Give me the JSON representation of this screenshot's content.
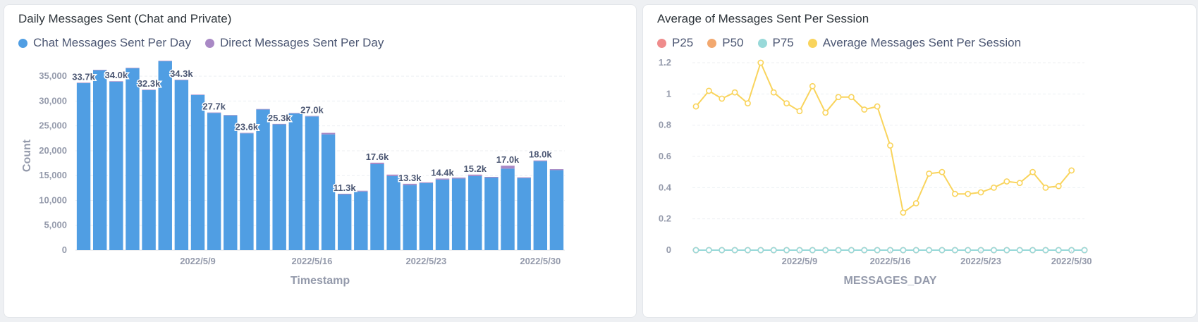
{
  "left_card": {
    "title": "Daily Messages Sent (Chat and Private)",
    "legend": [
      {
        "label": "Chat Messages Sent Per Day",
        "color": "#509ee3"
      },
      {
        "label": "Direct Messages Sent Per Day",
        "color": "#a989c5"
      }
    ]
  },
  "right_card": {
    "title": "Average of Messages Sent Per Session",
    "legend": [
      {
        "label": "P25",
        "color": "#ef8c8c"
      },
      {
        "label": "P50",
        "color": "#f2a86f"
      },
      {
        "label": "P75",
        "color": "#98d9d9"
      },
      {
        "label": "Average Messages Sent Per Session",
        "color": "#f9d45c"
      }
    ]
  },
  "chart_data": [
    {
      "type": "bar",
      "stacked": true,
      "title": "Daily Messages Sent (Chat and Private)",
      "xlabel": "Timestamp",
      "ylabel": "Count",
      "ylim": [
        0,
        38000
      ],
      "yticks": [
        0,
        5000,
        10000,
        15000,
        20000,
        25000,
        30000,
        35000
      ],
      "ytick_labels": [
        "0",
        "5,000",
        "10,000",
        "15,000",
        "20,000",
        "25,000",
        "30,000",
        "35,000"
      ],
      "xtick_labels": [
        {
          "label": "2022/5/9",
          "at": "2022-05-09"
        },
        {
          "label": "2022/5/16",
          "at": "2022-05-16"
        },
        {
          "label": "2022/5/23",
          "at": "2022-05-23"
        },
        {
          "label": "2022/5/30",
          "at": "2022-05-30"
        }
      ],
      "grid": true,
      "legend_position": "top-left",
      "categories": [
        "2022-05-02",
        "2022-05-03",
        "2022-05-04",
        "2022-05-05",
        "2022-05-06",
        "2022-05-07",
        "2022-05-08",
        "2022-05-09",
        "2022-05-10",
        "2022-05-11",
        "2022-05-12",
        "2022-05-13",
        "2022-05-14",
        "2022-05-15",
        "2022-05-16",
        "2022-05-17",
        "2022-05-18",
        "2022-05-19",
        "2022-05-20",
        "2022-05-21",
        "2022-05-22",
        "2022-05-23",
        "2022-05-24",
        "2022-05-25",
        "2022-05-26",
        "2022-05-27",
        "2022-05-28",
        "2022-05-29",
        "2022-05-30",
        "2022-05-31"
      ],
      "series": [
        {
          "name": "Chat Messages Sent Per Day",
          "color": "#509ee3",
          "values": [
            33600,
            36200,
            33900,
            36600,
            32200,
            38000,
            34200,
            31200,
            27600,
            27100,
            23500,
            28300,
            25300,
            27500,
            26900,
            23300,
            11200,
            11800,
            17300,
            14900,
            13100,
            13500,
            14200,
            14400,
            14900,
            14600,
            16400,
            14500,
            17900,
            16100
          ]
        },
        {
          "name": "Direct Messages Sent Per Day",
          "color": "#a989c5",
          "values": [
            100,
            100,
            100,
            100,
            100,
            100,
            100,
            100,
            100,
            100,
            100,
            100,
            100,
            100,
            100,
            300,
            150,
            150,
            300,
            300,
            250,
            150,
            200,
            200,
            300,
            150,
            600,
            150,
            150,
            200
          ]
        }
      ],
      "data_labels": [
        {
          "index": 0,
          "text": "33.7k"
        },
        {
          "index": 2,
          "text": "34.0k"
        },
        {
          "index": 4,
          "text": "32.3k"
        },
        {
          "index": 6,
          "text": "34.3k"
        },
        {
          "index": 8,
          "text": "27.7k"
        },
        {
          "index": 10,
          "text": "23.6k"
        },
        {
          "index": 12,
          "text": "25.3k"
        },
        {
          "index": 14,
          "text": "27.0k"
        },
        {
          "index": 16,
          "text": "11.3k"
        },
        {
          "index": 18,
          "text": "17.6k"
        },
        {
          "index": 20,
          "text": "13.3k"
        },
        {
          "index": 22,
          "text": "14.4k"
        },
        {
          "index": 24,
          "text": "15.2k"
        },
        {
          "index": 26,
          "text": "17.0k"
        },
        {
          "index": 28,
          "text": "18.0k"
        }
      ]
    },
    {
      "type": "line",
      "title": "Average of Messages Sent Per Session",
      "xlabel": "MESSAGES_DAY",
      "ylabel": "",
      "ylim": [
        0,
        1.2
      ],
      "yticks": [
        0,
        0.2,
        0.4,
        0.6,
        0.8,
        1,
        1.2
      ],
      "ytick_labels": [
        "0",
        "0.2",
        "0.4",
        "0.6",
        "0.8",
        "1",
        "1.2"
      ],
      "xtick_labels": [
        {
          "label": "2022/5/9",
          "at": "2022-05-09"
        },
        {
          "label": "2022/5/16",
          "at": "2022-05-16"
        },
        {
          "label": "2022/5/23",
          "at": "2022-05-23"
        },
        {
          "label": "2022/5/30",
          "at": "2022-05-30"
        }
      ],
      "grid": true,
      "legend_position": "top-left",
      "x": [
        "2022-05-01",
        "2022-05-02",
        "2022-05-03",
        "2022-05-04",
        "2022-05-05",
        "2022-05-06",
        "2022-05-07",
        "2022-05-08",
        "2022-05-09",
        "2022-05-10",
        "2022-05-11",
        "2022-05-12",
        "2022-05-13",
        "2022-05-14",
        "2022-05-15",
        "2022-05-16",
        "2022-05-17",
        "2022-05-18",
        "2022-05-19",
        "2022-05-20",
        "2022-05-21",
        "2022-05-22",
        "2022-05-23",
        "2022-05-24",
        "2022-05-25",
        "2022-05-26",
        "2022-05-27",
        "2022-05-28",
        "2022-05-29",
        "2022-05-30",
        "2022-05-31"
      ],
      "series": [
        {
          "name": "P25",
          "color": "#ef8c8c",
          "values": [
            0,
            0,
            0,
            0,
            0,
            0,
            0,
            0,
            0,
            0,
            0,
            0,
            0,
            0,
            0,
            0,
            0,
            0,
            0,
            0,
            0,
            0,
            0,
            0,
            0,
            0,
            0,
            0,
            0,
            0,
            0
          ]
        },
        {
          "name": "P50",
          "color": "#f2a86f",
          "values": [
            0,
            0,
            0,
            0,
            0,
            0,
            0,
            0,
            0,
            0,
            0,
            0,
            0,
            0,
            0,
            0,
            0,
            0,
            0,
            0,
            0,
            0,
            0,
            0,
            0,
            0,
            0,
            0,
            0,
            0,
            0
          ]
        },
        {
          "name": "P75",
          "color": "#98d9d9",
          "values": [
            0,
            0,
            0,
            0,
            0,
            0,
            0,
            0,
            0,
            0,
            0,
            0,
            0,
            0,
            0,
            0,
            0,
            0,
            0,
            0,
            0,
            0,
            0,
            0,
            0,
            0,
            0,
            0,
            0,
            0,
            0
          ]
        },
        {
          "name": "Average Messages Sent Per Session",
          "color": "#f9d45c",
          "values": [
            0.92,
            1.02,
            0.97,
            1.01,
            0.94,
            1.2,
            1.01,
            0.94,
            0.89,
            1.05,
            0.88,
            0.98,
            0.98,
            0.9,
            0.92,
            0.67,
            0.24,
            0.3,
            0.49,
            0.5,
            0.36,
            0.36,
            0.37,
            0.4,
            0.44,
            0.43,
            0.5,
            0.4,
            0.41,
            0.51
          ]
        }
      ]
    }
  ]
}
